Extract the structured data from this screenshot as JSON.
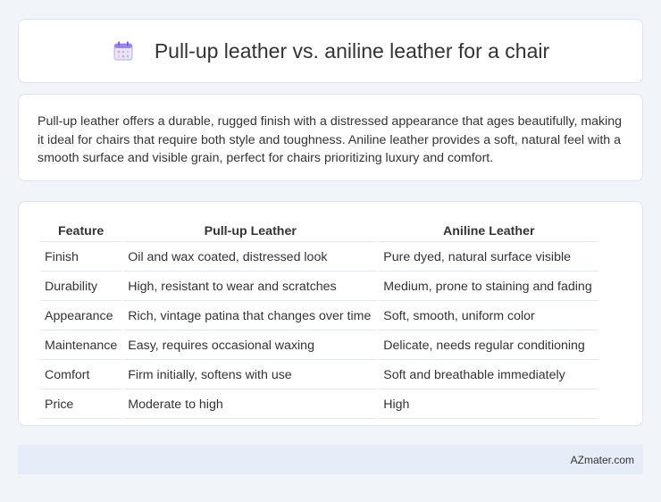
{
  "header": {
    "title": "Pull-up leather vs. aniline leather for a chair",
    "icon": "calendar-icon"
  },
  "description": {
    "text": "Pull-up leather offers a durable, rugged finish with a distressed appearance that ages beautifully, making it ideal for chairs that require both style and toughness. Aniline leather provides a soft, natural feel with a smooth surface and visible grain, perfect for chairs prioritizing luxury and comfort."
  },
  "table": {
    "headers": [
      "Feature",
      "Pull-up Leather",
      "Aniline Leather"
    ],
    "rows": [
      [
        "Finish",
        "Oil and wax coated, distressed look",
        "Pure dyed, natural surface visible"
      ],
      [
        "Durability",
        "High, resistant to wear and scratches",
        "Medium, prone to staining and fading"
      ],
      [
        "Appearance",
        "Rich, vintage patina that changes over time",
        "Soft, smooth, uniform color"
      ],
      [
        "Maintenance",
        "Easy, requires occasional waxing",
        "Delicate, needs regular conditioning"
      ],
      [
        "Comfort",
        "Firm initially, softens with use",
        "Soft and breathable immediately"
      ],
      [
        "Price",
        "Moderate to high",
        "High"
      ]
    ]
  },
  "footer": {
    "credit": "AZmater.com"
  },
  "colors": {
    "background": "#f1f4f9",
    "card": "#ffffff",
    "footer_bg": "#e6edf8",
    "text": "#333333"
  }
}
